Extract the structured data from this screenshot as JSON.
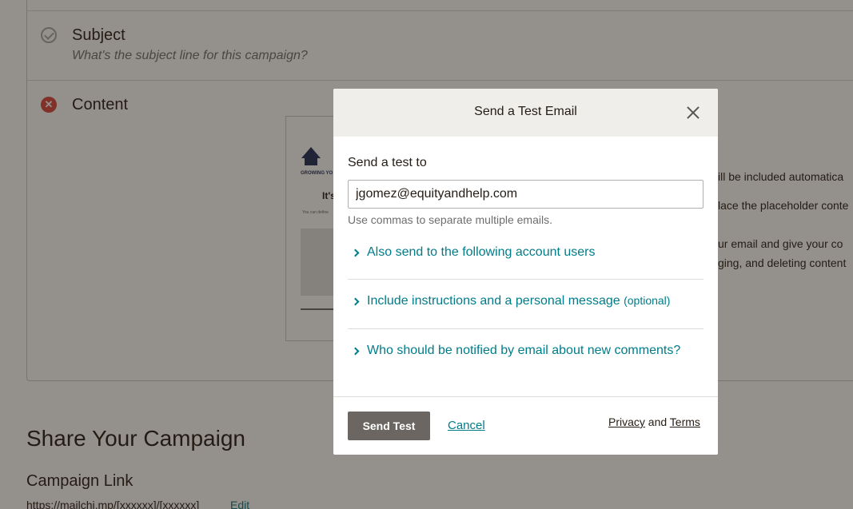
{
  "background": {
    "subject": {
      "title": "Subject",
      "description": "What's the subject line for this campaign?"
    },
    "content": {
      "title": "Content",
      "thumbnail_heading": "It's",
      "thumbnail_tagline": "GROWING YO",
      "thumbnail_small": "You can define"
    },
    "side_texts": [
      "ill be included automatica",
      "lace the placeholder conte",
      "ur email and give your co",
      "ging, and deleting content"
    ],
    "share": {
      "title": "Share Your Campaign",
      "link_title": "Campaign Link",
      "link_url": "https://mailchi.mp/[xxxxxx]/[xxxxxx]",
      "edit_label": "Edit"
    }
  },
  "modal": {
    "title": "Send a Test Email",
    "field_label": "Send a test to",
    "email_value": "jgomez@equityandhelp.com",
    "help_text": "Use commas to separate multiple emails.",
    "accordions": [
      {
        "label": "Also send to the following account users",
        "suffix": ""
      },
      {
        "label": "Include instructions and a personal message",
        "suffix": "(optional)"
      },
      {
        "label": "Who should be notified by email about new comments?",
        "suffix": ""
      }
    ],
    "footer": {
      "send_label": "Send Test",
      "cancel_label": "Cancel",
      "privacy_label": "Privacy",
      "and_label": "and",
      "terms_label": "Terms"
    }
  },
  "colors": {
    "accent": "#007c89",
    "error": "#d9453b",
    "button": "#6b6661",
    "header": "#efeeea"
  }
}
